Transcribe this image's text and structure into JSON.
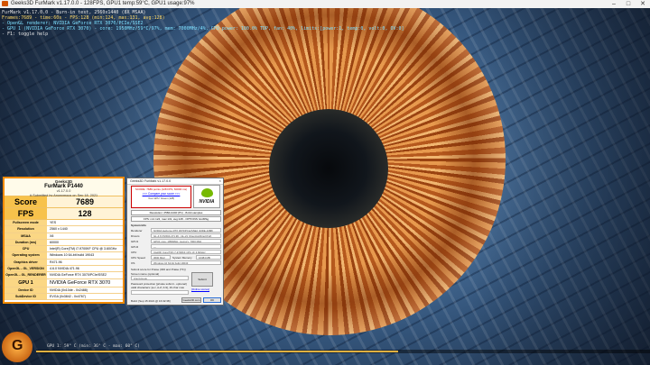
{
  "window": {
    "title": "Geeks3D FurMark v1.17.0.0 - 128FPS, GPU1 temp:59°C, GPU1 usage:97%"
  },
  "osd": {
    "line1": "FurMark v1.17.0.0 - Burn-in test, 2560x1440 (8X MSAA)",
    "line2": "Frames:7689 - time:60s - FPS:128 (min:124, max:131, avg:128)",
    "line3": "- OpenGL renderer: NVIDIA GeForce RTX 3070/PCIe/SSE2",
    "line4": "- GPU 1 (NVIDIA GeForce RTX 3070) - core: 1950MHz/59°C/97%, mem: 7000MHz/4%, GPU power: 100.0% TDP, fan: 40%, limits:[power:1, temp:0, volt:0, OV:0]",
    "line5": "- F1: toggle help"
  },
  "temp": {
    "label": "GPU 1: 59° C (min: 36° C - max: 60° C)",
    "fraction": 0.59,
    "color": "#e0b040"
  },
  "score_panel": {
    "brand": "Geeks3D",
    "title": "FurMark P1440",
    "version": "v1.17.0.0",
    "submitted": "#-Submitted by Anonymous on Sep 18, 2021",
    "score_label": "Score",
    "score": "7689",
    "fps_label": "FPS",
    "fps": "128",
    "rows": [
      {
        "k": "Fullscreen mode",
        "v": "YES"
      },
      {
        "k": "Resolution",
        "v": "2560 x 1440"
      },
      {
        "k": "MSAA",
        "v": "X8"
      },
      {
        "k": "Duration (ms)",
        "v": "60000"
      },
      {
        "k": "CPU",
        "v": "Intel(R) Core(TM) i7-9700KF CPU @ 3.60GHz"
      },
      {
        "k": "Operating system",
        "v": "Windows 10 64-bit build 19043"
      },
      {
        "k": "Graphics driver",
        "v": "R471.96"
      },
      {
        "k": "OpenGL - GL_VERSION",
        "v": "4.6.0 NVIDIA 471.96"
      },
      {
        "k": "OpenGL - GL_RENDERER",
        "v": "NVIDIA GeForce RTX 3070/PCIe/SSE2"
      }
    ],
    "gpu_label": "GPU 1",
    "gpu_value": "NVIDIA GeForce RTX 3070",
    "rows2": [
      {
        "k": "Device ID",
        "v": "NVIDIA (0x10de - 0x2488)"
      },
      {
        "k": "SubDevice ID",
        "v": "EVGA (0x3842 - 0x4767)"
      }
    ],
    "accent": "#f08a00"
  },
  "dialog": {
    "title": "Geeks3D FurMark v1.17.0.0",
    "x": "×",
    "score_line": "SCORE: 7689 points (128 FPS, 60000 ms)",
    "compare": ">>> Compare your score <<<",
    "your_gpu": "Your GPU: Green (128)",
    "resolution": "Resolution: 2560x1440 (P1) - 8xAA samples",
    "fps_line": "FPS: min:124, max:131, avg:128 - OPTIONS: ExtMSg",
    "system_info": "System Info",
    "renderer_label": "Renderer",
    "renderer": "NVIDIA GeForce RTX 3070/PCIe/SSE2 (10DE-2488)",
    "drivers_label": "Drivers",
    "drivers": "GL-4.6 NVIDIA 471.96 - GL-21 (OpenGL/DirectX12)",
    "gpu1_label": "GPU1",
    "gpu1": "GPU1 core: 1950MHz, memory: 7000 MHz",
    "gpu2_label": "GPU2",
    "gpu2": "—",
    "cpu_label": "CPU",
    "cpu": "Intel(R) Core(TM) i7-9700KF CPU @ 3.60GHz",
    "cpu_speed_label": "CPU Speed",
    "cpu_speed": "3600 MHz",
    "sysmem_label": "System Memory",
    "sysmem": "16384 MB",
    "os_label": "OS",
    "os": "Windows 10 64-bit build 19043",
    "submit_text": "Submit score for Praise (300 and Praise (TF))",
    "screen_name_label": "Screen name (optional)",
    "screen_name": "Anonymous",
    "submit_btn": "Submit",
    "online_link": "[Online scores]",
    "pwd_label": "Password protection [private submit - optional]",
    "pwd_hint": "valid characters: [a-z, A-Z, 0-9], 16 char max",
    "build": "Build: [Sep 15 2021 @ 16:32:38]",
    "geeks_btn": "Geeks3D.com",
    "ok_btn": "OK"
  }
}
